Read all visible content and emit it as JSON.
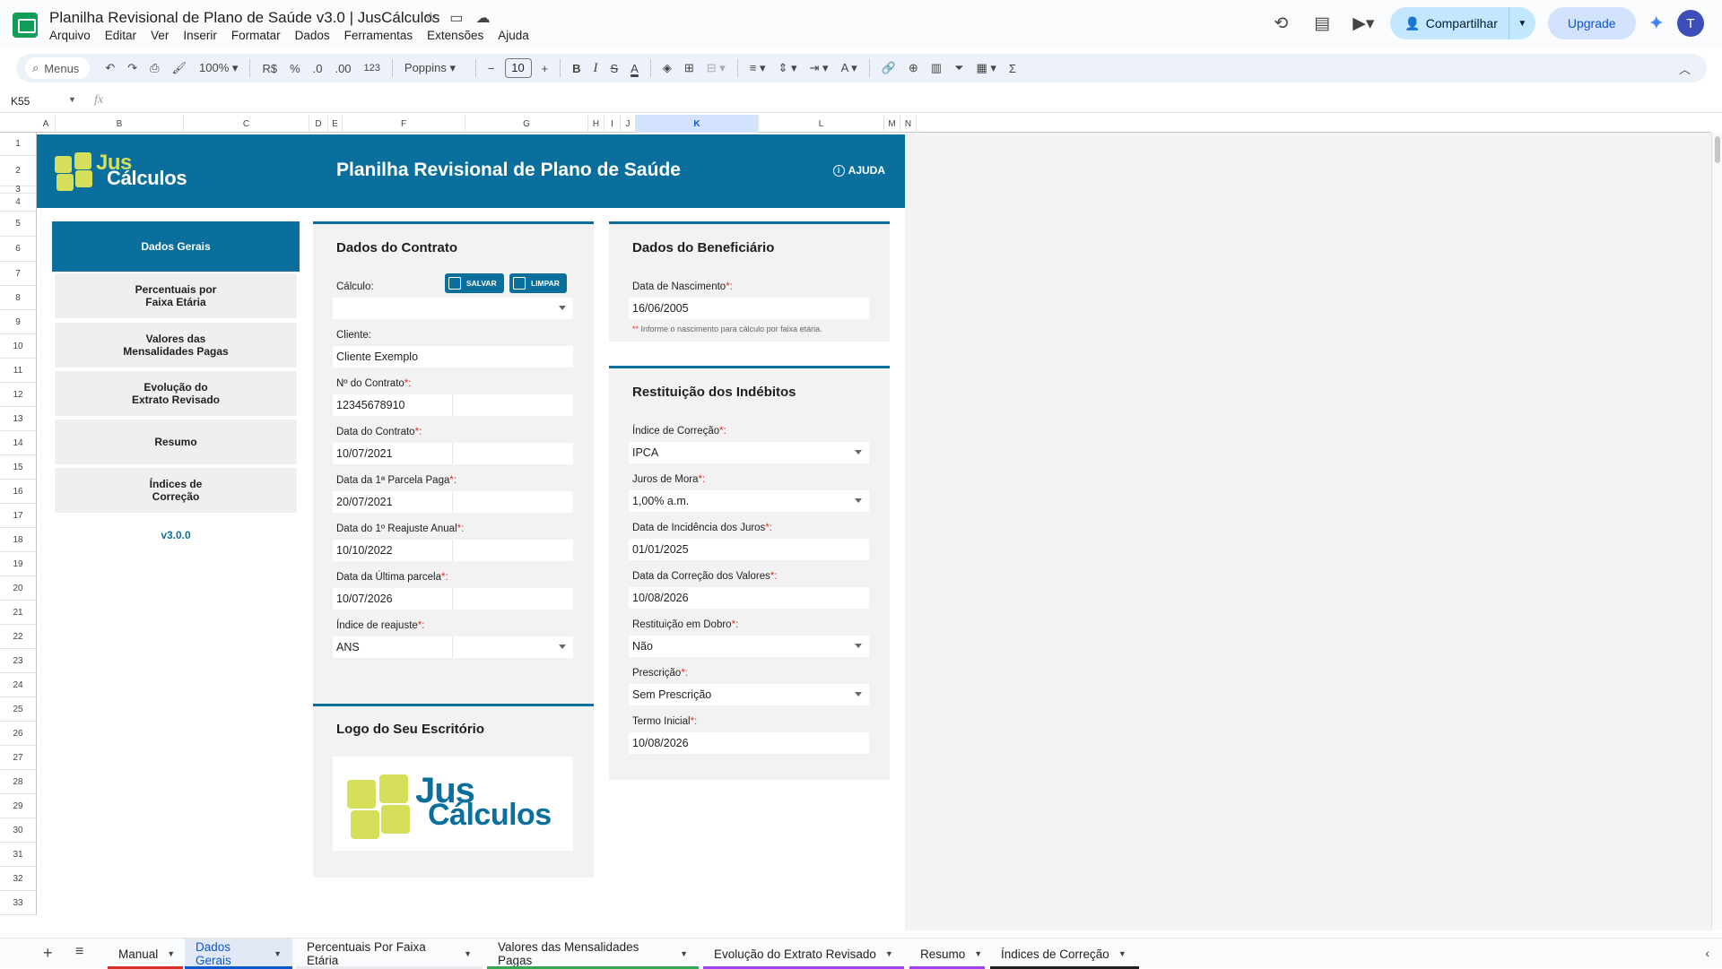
{
  "doc": {
    "title": "Planilha Revisional de Plano de Saúde v3.0 | JusCálculos",
    "menu": [
      "Arquivo",
      "Editar",
      "Ver",
      "Inserir",
      "Formatar",
      "Dados",
      "Ferramentas",
      "Extensões",
      "Ajuda"
    ]
  },
  "topbar": {
    "share_label": "Compartilhar",
    "upgrade_label": "Upgrade",
    "avatar_letter": "T"
  },
  "toolbar": {
    "search_label": "Menus",
    "zoom": "100%",
    "currency": "R$",
    "percent": "%",
    "dec_less": ".0",
    "dec_more": ".00",
    "number_format": "123",
    "font": "Poppins",
    "font_size": "10",
    "bold": "B",
    "italic": "I",
    "strike": "S",
    "text_color": "A",
    "text_color2": "A",
    "sum": "Σ"
  },
  "formula": {
    "cell_ref": "K55",
    "fx": "fx"
  },
  "columns": [
    "A",
    "B",
    "C",
    "D",
    "E",
    "F",
    "G",
    "H",
    "I",
    "J",
    "K",
    "L",
    "M",
    "N"
  ],
  "rows": [
    "1",
    "2",
    "3",
    "4",
    "5",
    "6",
    "7",
    "8",
    "9",
    "10",
    "11",
    "12",
    "13",
    "14",
    "15",
    "16",
    "17",
    "18",
    "19",
    "20",
    "21",
    "22",
    "23",
    "24",
    "25",
    "26",
    "27",
    "28",
    "29",
    "30",
    "31",
    "32",
    "33"
  ],
  "banner": {
    "brand_jus": "Jus",
    "brand_calculos": "Cálculos",
    "title": "Planilha Revisional de Plano de Saúde",
    "help_label": "AJUDA",
    "primary_color": "#0a6f9c",
    "accent_color": "#d5df5a"
  },
  "nav": {
    "items": [
      {
        "label": "Dados Gerais"
      },
      {
        "label": "Percentuais por\nFaixa Etária"
      },
      {
        "label": "Valores das\nMensalidades Pagas"
      },
      {
        "label": "Evolução do\nExtrato Revisado"
      },
      {
        "label": "Resumo"
      },
      {
        "label": "Índices de\nCorreção"
      }
    ],
    "version": "v3.0.0"
  },
  "contrato": {
    "title": "Dados do Contrato",
    "calculo_label": "Cálculo:",
    "save_label": "SALVAR",
    "clear_label": "LIMPAR",
    "calculo_value": "",
    "cliente_label": "Cliente:",
    "cliente_value": "Cliente Exemplo",
    "contrato_label": "Nº do Contrato",
    "contrato_value": "12345678910",
    "data_contrato_label": "Data do Contrato",
    "data_contrato_value": "10/07/2021",
    "primeira_parcela_label": "Data da 1ª Parcela Paga",
    "primeira_parcela_value": "20/07/2021",
    "primeiro_reajuste_label": "Data do 1º Reajuste Anual",
    "primeiro_reajuste_value": "10/10/2022",
    "ultima_parcela_label": "Data da Última parcela",
    "ultima_parcela_value": "10/07/2026",
    "indice_reajuste_label": "Índice de reajuste",
    "indice_reajuste_value": "ANS",
    "req_mark": "*:"
  },
  "logo_card": {
    "title": "Logo do Seu Escritório",
    "brand_jus": "Jus",
    "brand_calculos": "Cálculos"
  },
  "beneficiario": {
    "title": "Dados do Beneficiário",
    "nascimento_label": "Data de Nascimento",
    "nascimento_value": "16/06/2005",
    "note_stars": "**",
    "note_text": "Informe o nascimento para cálculo por faixa etária."
  },
  "restituicao": {
    "title": "Restituição dos Indébitos",
    "indice_label": "Índice de Correção",
    "indice_value": "IPCA",
    "juros_label": "Juros de Mora",
    "juros_value": "1,00% a.m.",
    "incidencia_label": "Data de Incidência dos Juros",
    "incidencia_value": "01/01/2025",
    "correcao_label": "Data da Correção dos Valores",
    "correcao_value": "10/08/2026",
    "dobro_label": "Restituição em Dobro",
    "dobro_value": "Não",
    "prescricao_label": "Prescrição",
    "prescricao_value": "Sem Prescrição",
    "termo_label": "Termo Inicial",
    "termo_value": "10/08/2026"
  },
  "tabs": [
    {
      "label": "Manual",
      "color": "#d93025"
    },
    {
      "label": "Dados Gerais",
      "color": "#0b57d0"
    },
    {
      "label": "Percentuais Por Faixa Etária",
      "color": "#e8eaed"
    },
    {
      "label": "Valores das Mensalidades Pagas",
      "color": "#34a853"
    },
    {
      "label": "Evolução do Extrato Revisado",
      "color": "#a142f4"
    },
    {
      "label": "Resumo",
      "color": "#a142f4"
    },
    {
      "label": "Índices de Correção",
      "color": "#1f1f1f"
    }
  ]
}
